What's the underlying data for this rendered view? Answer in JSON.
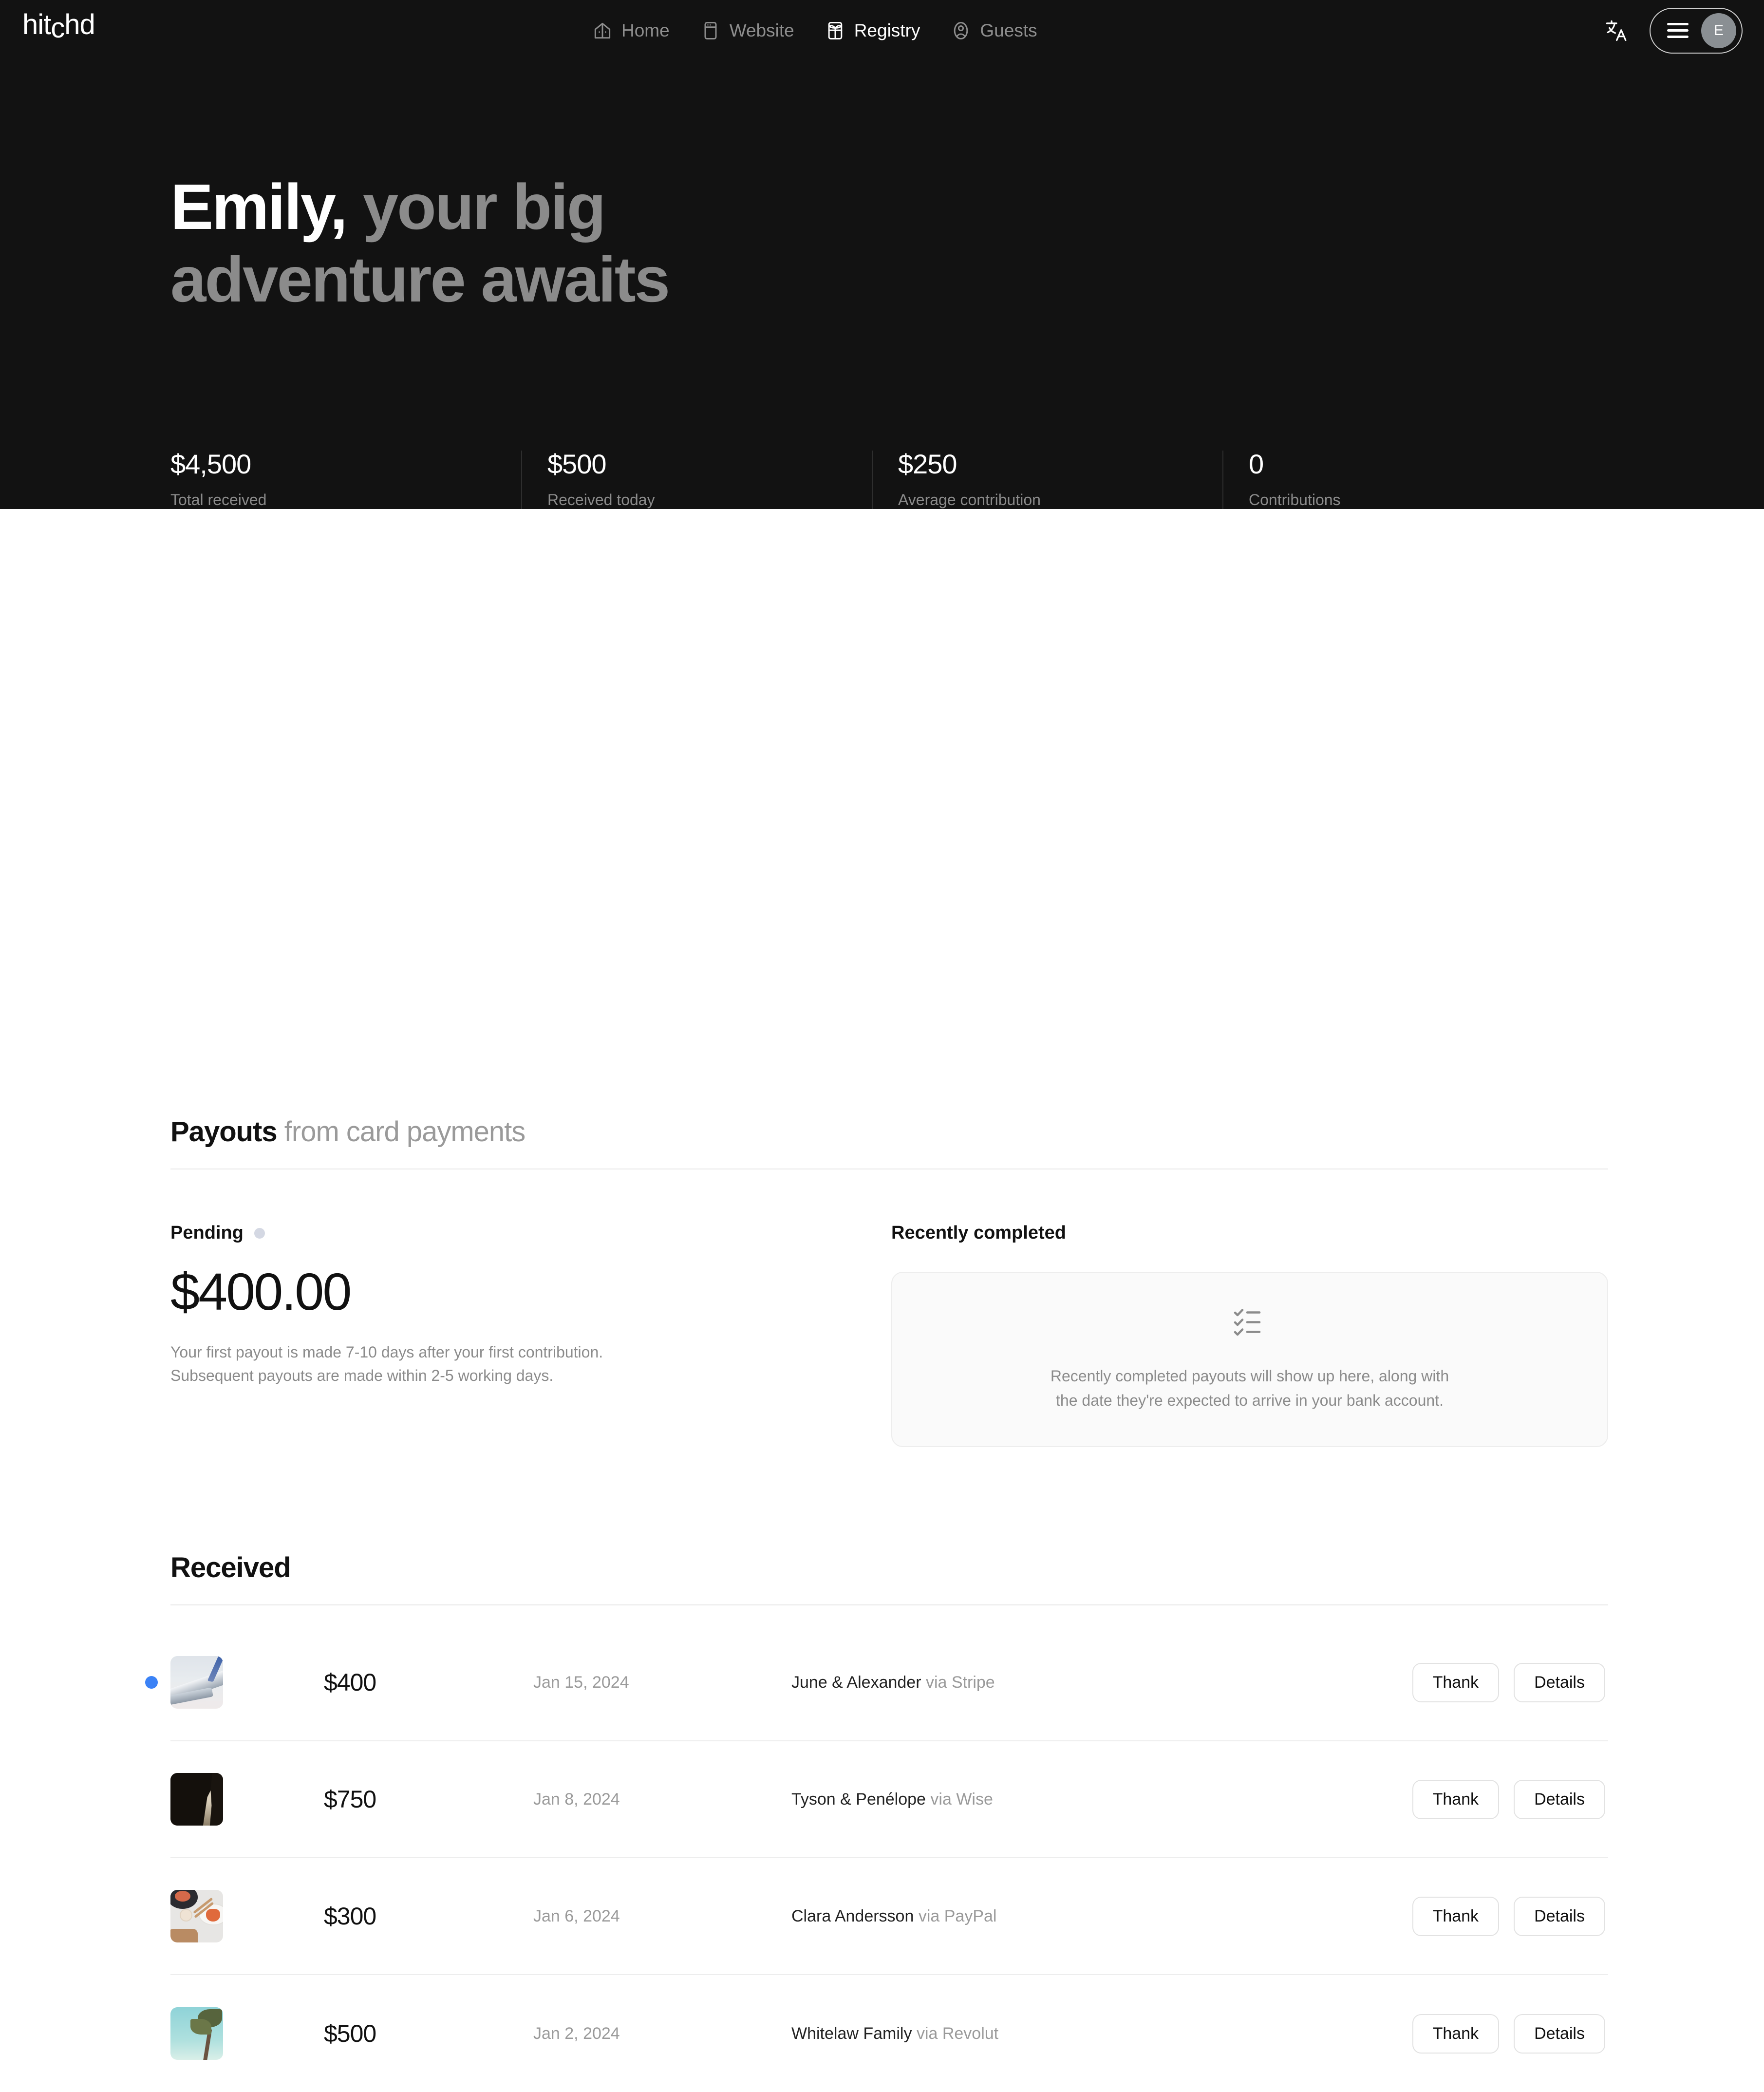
{
  "brand": {
    "name_part1": "hit",
    "name_c": "c",
    "name_part2": "hd"
  },
  "nav": {
    "items": [
      {
        "label": "Home",
        "icon": "house-icon",
        "active": false
      },
      {
        "label": "Website",
        "icon": "browser-window-icon",
        "active": false
      },
      {
        "label": "Registry",
        "icon": "gift-icon",
        "active": true
      },
      {
        "label": "Guests",
        "icon": "person-circle-icon",
        "active": false
      }
    ],
    "translate_icon": "translate-icon",
    "menu_icon": "hamburger-icon",
    "avatar_initial": "E"
  },
  "hero": {
    "greeting_name": "Emily,",
    "greeting_rest": "your big adventure awaits",
    "stats": [
      {
        "value": "$4,500",
        "label": "Total received"
      },
      {
        "value": "$500",
        "label": "Received today"
      },
      {
        "value": "$250",
        "label": "Average contribution"
      },
      {
        "value": "0",
        "label": "Contributions"
      }
    ]
  },
  "payouts": {
    "title": "Payouts",
    "title_muted": "from card payments",
    "pending": {
      "label": "Pending",
      "status_dot_color": "#d4d8e3",
      "amount": "$400.00",
      "note_line1": "Your first payout is made 7-10 days after your first contribution.",
      "note_line2": "Subsequent payouts are made within 2-5 working days."
    },
    "completed": {
      "label": "Recently completed",
      "empty_icon": "checklist-icon",
      "empty_line1": "Recently completed payouts will show up here, along with",
      "empty_line2": "the date they're expected to arrive in your bank account."
    }
  },
  "received": {
    "title": "Received",
    "thank_label": "Thank",
    "details_label": "Details",
    "unread_dot_color": "#3b82f6",
    "rows": [
      {
        "amount": "$400",
        "date": "Jan 15, 2024",
        "from": "June & Alexander",
        "via": "via Stripe",
        "thumb": "airplane-wing-photo",
        "unread": true
      },
      {
        "amount": "$750",
        "date": "Jan 8, 2024",
        "from": "Tyson & Penélope",
        "via": "via Wise",
        "thumb": "cave-opening-photo",
        "unread": false
      },
      {
        "amount": "$300",
        "date": "Jan 6, 2024",
        "from": "Clara Andersson",
        "via": "via PayPal",
        "thumb": "seafood-table-photo",
        "unread": false
      },
      {
        "amount": "$500",
        "date": "Jan 2, 2024",
        "from": "Whitelaw Family",
        "via": "via Revolut",
        "thumb": "palm-beach-photo",
        "unread": false
      }
    ]
  }
}
